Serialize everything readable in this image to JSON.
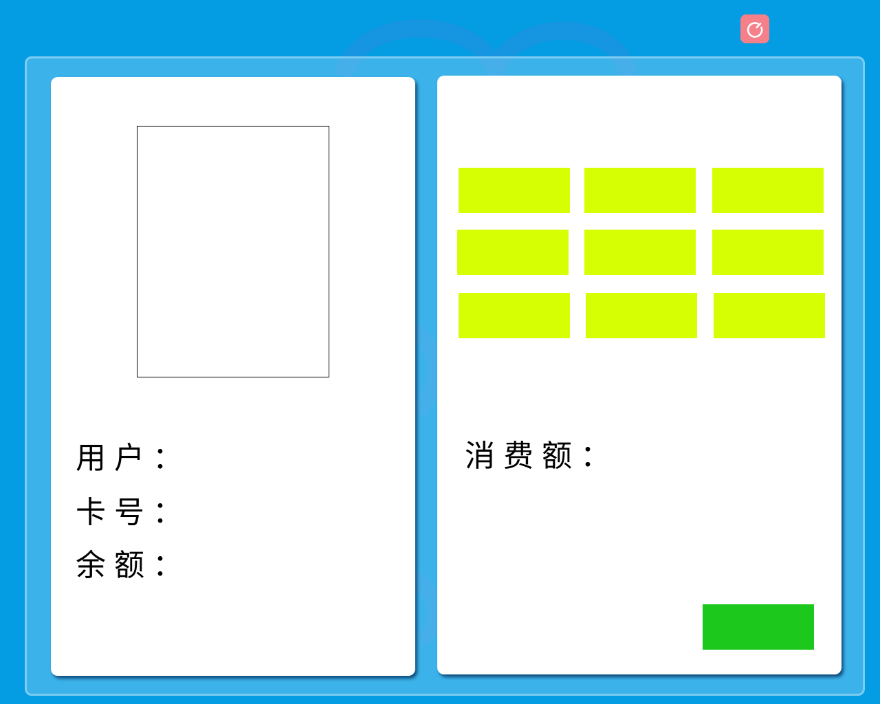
{
  "power_button": {
    "icon": "power-icon",
    "color": "#f5808a"
  },
  "user_info": {
    "user_label": "用户：",
    "card_label": "卡号：",
    "balance_label": "余额："
  },
  "consume": {
    "amount_label": "消费额：",
    "amount_button_color": "#d6ff04",
    "amount_buttons": [
      "",
      "",
      "",
      "",
      "",
      "",
      "",
      "",
      ""
    ],
    "confirm_button_color": "#1cc81c",
    "confirm_label": ""
  },
  "colors": {
    "background": "#049ce3",
    "panel": "#ffffff"
  }
}
